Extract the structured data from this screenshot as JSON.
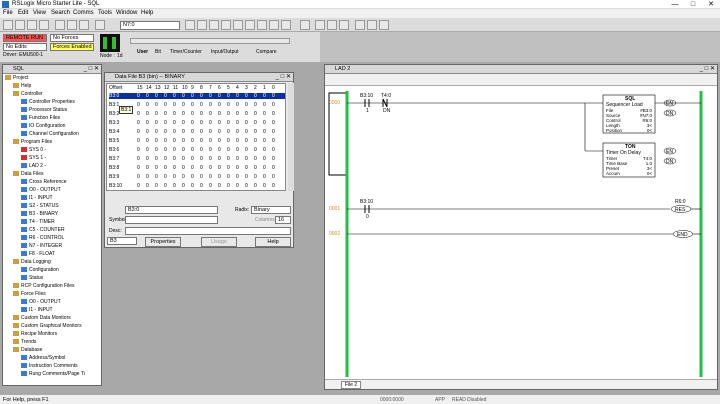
{
  "window": {
    "title": "RSLogix Micro Starter Lite - SQL"
  },
  "menu": [
    "File",
    "Edit",
    "View",
    "Search",
    "Comms",
    "Tools",
    "Window",
    "Help"
  ],
  "toolbar": {
    "address_field": "N7:0"
  },
  "status": {
    "mode": "REMOTE RUN",
    "forces": "No Forces",
    "edits": "No Edits",
    "forces_enabled": "Forces Enabled",
    "driver": "Driver: EMU500-1",
    "node_label": "Node :",
    "node_value": "1d",
    "tabs": [
      "User",
      "Bit",
      "Timer/Counter",
      "Input/Output",
      "Compare"
    ]
  },
  "project_panel": {
    "title": "SQL",
    "tree": [
      {
        "label": "Project",
        "level": 0,
        "color": "#c8a040"
      },
      {
        "label": "Help",
        "level": 1,
        "color": "#c8a040"
      },
      {
        "label": "Controller",
        "level": 1,
        "color": "#c8a040"
      },
      {
        "label": "Controller Properties",
        "level": 2,
        "color": "#3a7ad0"
      },
      {
        "label": "Processor Status",
        "level": 2,
        "color": "#3a7ad0"
      },
      {
        "label": "Function Files",
        "level": 2,
        "color": "#3a7ad0"
      },
      {
        "label": "IO Configuration",
        "level": 2,
        "color": "#3a7ad0"
      },
      {
        "label": "Channel Configuration",
        "level": 2,
        "color": "#3a7ad0"
      },
      {
        "label": "Program Files",
        "level": 1,
        "color": "#c8a040"
      },
      {
        "label": "SYS 0 -",
        "level": 2,
        "color": "#d03030"
      },
      {
        "label": "SYS 1 -",
        "level": 2,
        "color": "#d03030"
      },
      {
        "label": "LAD 2 -",
        "level": 2,
        "color": "#3a7ad0"
      },
      {
        "label": "Data Files",
        "level": 1,
        "color": "#c8a040"
      },
      {
        "label": "Cross Reference",
        "level": 2,
        "color": "#3a7ad0"
      },
      {
        "label": "O0 - OUTPUT",
        "level": 2,
        "color": "#3a7ad0"
      },
      {
        "label": "I1 - INPUT",
        "level": 2,
        "color": "#3a7ad0"
      },
      {
        "label": "S2 - STATUS",
        "level": 2,
        "color": "#3a7ad0"
      },
      {
        "label": "B3 - BINARY",
        "level": 2,
        "color": "#3a7ad0"
      },
      {
        "label": "T4 - TIMER",
        "level": 2,
        "color": "#3a7ad0"
      },
      {
        "label": "C5 - COUNTER",
        "level": 2,
        "color": "#3a7ad0"
      },
      {
        "label": "R6 - CONTROL",
        "level": 2,
        "color": "#3a7ad0"
      },
      {
        "label": "N7 - INTEGER",
        "level": 2,
        "color": "#3a7ad0"
      },
      {
        "label": "F8 - FLOAT",
        "level": 2,
        "color": "#3a7ad0"
      },
      {
        "label": "Data Logging",
        "level": 1,
        "color": "#c8a040"
      },
      {
        "label": "Configuration",
        "level": 2,
        "color": "#3a7ad0"
      },
      {
        "label": "Status",
        "level": 2,
        "color": "#3a7ad0"
      },
      {
        "label": "RCP Configuration Files",
        "level": 1,
        "color": "#c8a040"
      },
      {
        "label": "Force Files",
        "level": 1,
        "color": "#c8a040"
      },
      {
        "label": "O0 - OUTPUT",
        "level": 2,
        "color": "#3a7ad0"
      },
      {
        "label": "I1 - INPUT",
        "level": 2,
        "color": "#3a7ad0"
      },
      {
        "label": "Custom Data Monitors",
        "level": 1,
        "color": "#c8a040"
      },
      {
        "label": "Custom Graphical Monitors",
        "level": 1,
        "color": "#c8a040"
      },
      {
        "label": "Recipe Monitors",
        "level": 1,
        "color": "#c8a040"
      },
      {
        "label": "Trends",
        "level": 1,
        "color": "#c8a040"
      },
      {
        "label": "Database",
        "level": 1,
        "color": "#c8a040"
      },
      {
        "label": "Address/Symbol",
        "level": 2,
        "color": "#3a7ad0"
      },
      {
        "label": "Instruction Comments",
        "level": 2,
        "color": "#3a7ad0"
      },
      {
        "label": "Rung Comments/Page Ti",
        "level": 2,
        "color": "#3a7ad0"
      }
    ]
  },
  "data_file": {
    "title": "Data File B3 (bin) -- BINARY",
    "header_offset": "Offset",
    "bits": [
      "15",
      "14",
      "13",
      "12",
      "11",
      "10",
      "9",
      "8",
      "7",
      "6",
      "5",
      "4",
      "3",
      "2",
      "1",
      "0"
    ],
    "rows": [
      {
        "offset": "B3:0",
        "values": [
          "0",
          "0",
          "0",
          "0",
          "0",
          "0",
          "0",
          "0",
          "0",
          "0",
          "0",
          "0",
          "0",
          "0",
          "0",
          "0"
        ]
      },
      {
        "offset": "B3:1",
        "values": [
          "0",
          "0",
          "0",
          "0",
          "0",
          "0",
          "0",
          "0",
          "0",
          "0",
          "0",
          "0",
          "0",
          "0",
          "0",
          "0"
        ]
      },
      {
        "offset": "B3:2",
        "values": [
          "0",
          "0",
          "0",
          "0",
          "0",
          "0",
          "0",
          "0",
          "0",
          "0",
          "0",
          "0",
          "0",
          "0",
          "0",
          "0"
        ]
      },
      {
        "offset": "B3:3",
        "values": [
          "0",
          "0",
          "0",
          "0",
          "0",
          "0",
          "0",
          "0",
          "0",
          "0",
          "0",
          "0",
          "0",
          "0",
          "0",
          "0"
        ]
      },
      {
        "offset": "B3:4",
        "values": [
          "0",
          "0",
          "0",
          "0",
          "0",
          "0",
          "0",
          "0",
          "0",
          "0",
          "0",
          "0",
          "0",
          "0",
          "0",
          "0"
        ]
      },
      {
        "offset": "B3:5",
        "values": [
          "0",
          "0",
          "0",
          "0",
          "0",
          "0",
          "0",
          "0",
          "0",
          "0",
          "0",
          "0",
          "0",
          "0",
          "0",
          "0"
        ]
      },
      {
        "offset": "B3:6",
        "values": [
          "0",
          "0",
          "0",
          "0",
          "0",
          "0",
          "0",
          "0",
          "0",
          "0",
          "0",
          "0",
          "0",
          "0",
          "0",
          "0"
        ]
      },
      {
        "offset": "B3:7",
        "values": [
          "0",
          "0",
          "0",
          "0",
          "0",
          "0",
          "0",
          "0",
          "0",
          "0",
          "0",
          "0",
          "0",
          "0",
          "0",
          "0"
        ]
      },
      {
        "offset": "B3:8",
        "values": [
          "0",
          "0",
          "0",
          "0",
          "0",
          "0",
          "0",
          "0",
          "0",
          "0",
          "0",
          "0",
          "0",
          "0",
          "0",
          "0"
        ]
      },
      {
        "offset": "B3:9",
        "values": [
          "0",
          "0",
          "0",
          "0",
          "0",
          "0",
          "0",
          "0",
          "0",
          "0",
          "0",
          "0",
          "0",
          "0",
          "0",
          "0"
        ]
      },
      {
        "offset": "B3:10",
        "values": [
          "0",
          "0",
          "0",
          "0",
          "0",
          "0",
          "0",
          "0",
          "0",
          "0",
          "0",
          "0",
          "0",
          "0",
          "0",
          "0"
        ]
      }
    ],
    "tooltip": "B3:1",
    "address_value": "B3:0",
    "radix_label": "Radix:",
    "radix_value": "Binary",
    "symbol_label": "Symbol:",
    "columns_label": "Columns:",
    "columns_value": "16",
    "desc_label": "Desc:",
    "file_value": "B3",
    "properties_btn": "Properties",
    "usage_btn": "Usage",
    "help_btn": "Help"
  },
  "ladder": {
    "title": "LAD 2",
    "rungs": [
      {
        "num": "0000",
        "contact1": "B3:10",
        "contact1_bit": "1",
        "contact2": "T4:0",
        "contact2_bit": "DN"
      },
      {
        "num": "0001",
        "contact": "B3:10",
        "contact_bit": "0",
        "coil": "R6:0",
        "coil_bit": "RES"
      },
      {
        "num": "0002",
        "end": "END"
      }
    ],
    "sql": {
      "title": "SQL",
      "subtitle": "Sequencer Load",
      "rows": [
        [
          "File",
          "#B3:0"
        ],
        [
          "Source",
          "#N7:0"
        ],
        [
          "Control",
          "R6:0"
        ],
        [
          "Length",
          "3<"
        ],
        [
          "Position",
          "0<"
        ]
      ],
      "outputs": [
        "EN",
        "DN"
      ]
    },
    "ton": {
      "title": "TON",
      "subtitle": "Timer On Delay",
      "rows": [
        [
          "Timer",
          "T4:0"
        ],
        [
          "Time Base",
          "1.0"
        ],
        [
          "Preset",
          "3<"
        ],
        [
          "Accum",
          "0<"
        ]
      ],
      "outputs": [
        "EN",
        "DN"
      ]
    },
    "tab": "File 2"
  },
  "statusbar": {
    "help": "For Help, press F1",
    "addr": "0000:0000",
    "app": "APP",
    "mode": "READ",
    "state": "Disabled"
  }
}
